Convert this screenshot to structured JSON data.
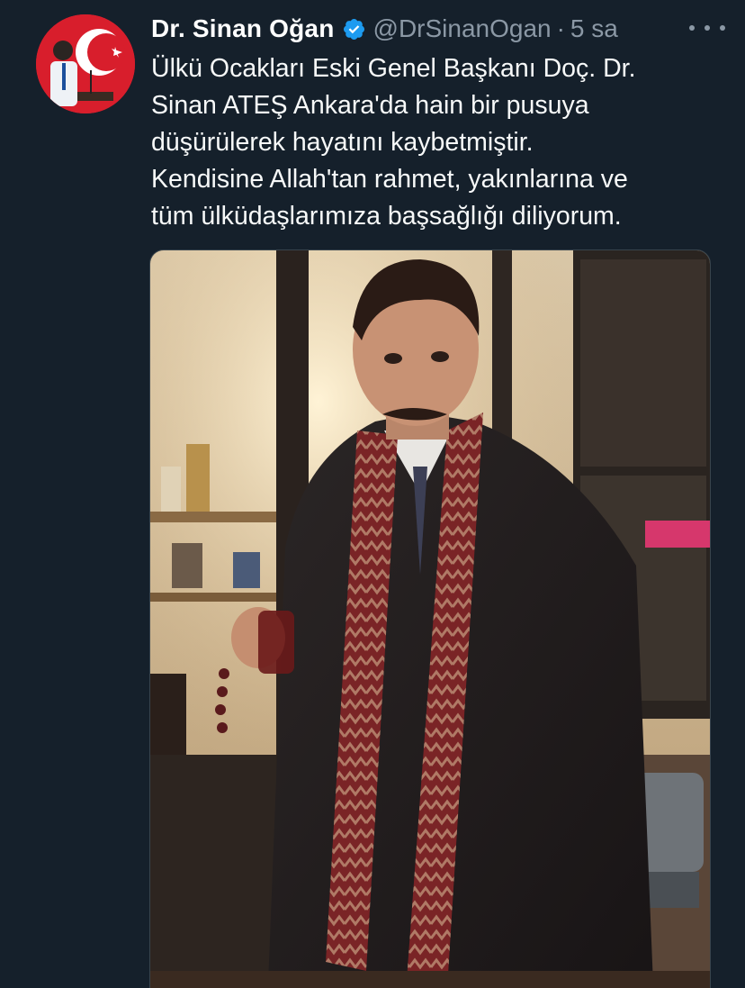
{
  "tweet": {
    "author_name": "Dr. Sinan Oğan",
    "verified_icon": "verified-badge-icon",
    "handle": "@DrSinanOgan",
    "separator": "·",
    "time": "5 sa",
    "more_icon": "more-options-icon",
    "text_lines": [
      "Ülkü Ocakları Eski Genel Başkanı Doç. Dr.",
      "Sinan ATEŞ Ankara'da hain bir pusuya",
      "düşürülerek hayatını kaybetmiştir.",
      "Kendisine Allah'tan rahmet, yakınlarına ve",
      "tüm ülküdaşlarımıza başsağlığı diliyorum."
    ]
  },
  "colors": {
    "background": "#15202b",
    "text": "#f7f9f9",
    "secondary": "#8b98a5",
    "verified": "#1d9bf0"
  }
}
